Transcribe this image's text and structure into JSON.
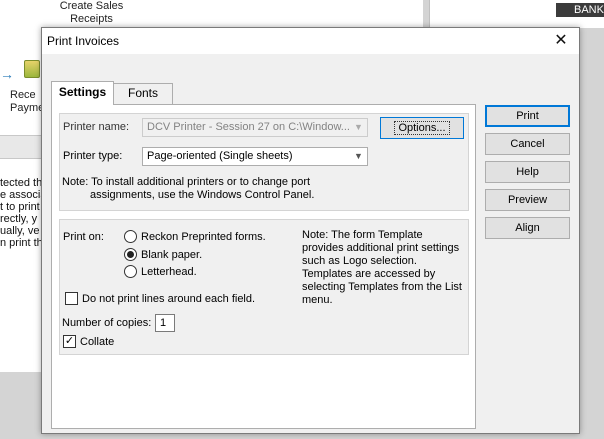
{
  "background": {
    "create_sales_line1": "Create Sales",
    "create_sales_line2": "Receipts",
    "receive_payments_line1": "Rece",
    "receive_payments_line2": "Payme",
    "arrow_glyph": "→",
    "text_lines": [
      "tected th",
      "e associa",
      "t to print",
      "rectly, y",
      "ually, ve",
      "n print th"
    ],
    "bank_badge": "BANK"
  },
  "dialog": {
    "title": "Print Invoices",
    "close_glyph": "✕",
    "tabs": [
      {
        "label": "Settings",
        "active": true
      },
      {
        "label": "Fonts",
        "active": false
      }
    ],
    "printer": {
      "name_label": "Printer name:",
      "name_value": "DCV Printer - Session 27 on C:\\Window...",
      "options_label": "Options...",
      "type_label": "Printer type:",
      "type_value": "Page-oriented (Single sheets)",
      "note_line1": "Note: To install additional printers or to change port",
      "note_line2": "assignments, use the Windows Control Panel."
    },
    "print_on": {
      "label": "Print on:",
      "options": [
        {
          "label": "Reckon Preprinted forms.",
          "checked": false
        },
        {
          "label": "Blank paper.",
          "checked": true
        },
        {
          "label": "Letterhead.",
          "checked": false
        }
      ],
      "note_lines": [
        "Note: The form Template",
        "provides additional print settings",
        "such as Logo selection.",
        "Templates are accessed by",
        "selecting Templates from the List",
        "menu."
      ],
      "no_lines_label": "Do not print lines around each field.",
      "no_lines_checked": false,
      "copies_label": "Number of copies:",
      "copies_value": "1",
      "collate_label": "Collate",
      "collate_checked": true,
      "check_glyph": "✓"
    },
    "buttons": {
      "print": "Print",
      "cancel": "Cancel",
      "help": "Help",
      "preview": "Preview",
      "align": "Align"
    },
    "colors": {
      "accent": "#0078d7",
      "dialog_bg": "#f0f0f0"
    }
  }
}
